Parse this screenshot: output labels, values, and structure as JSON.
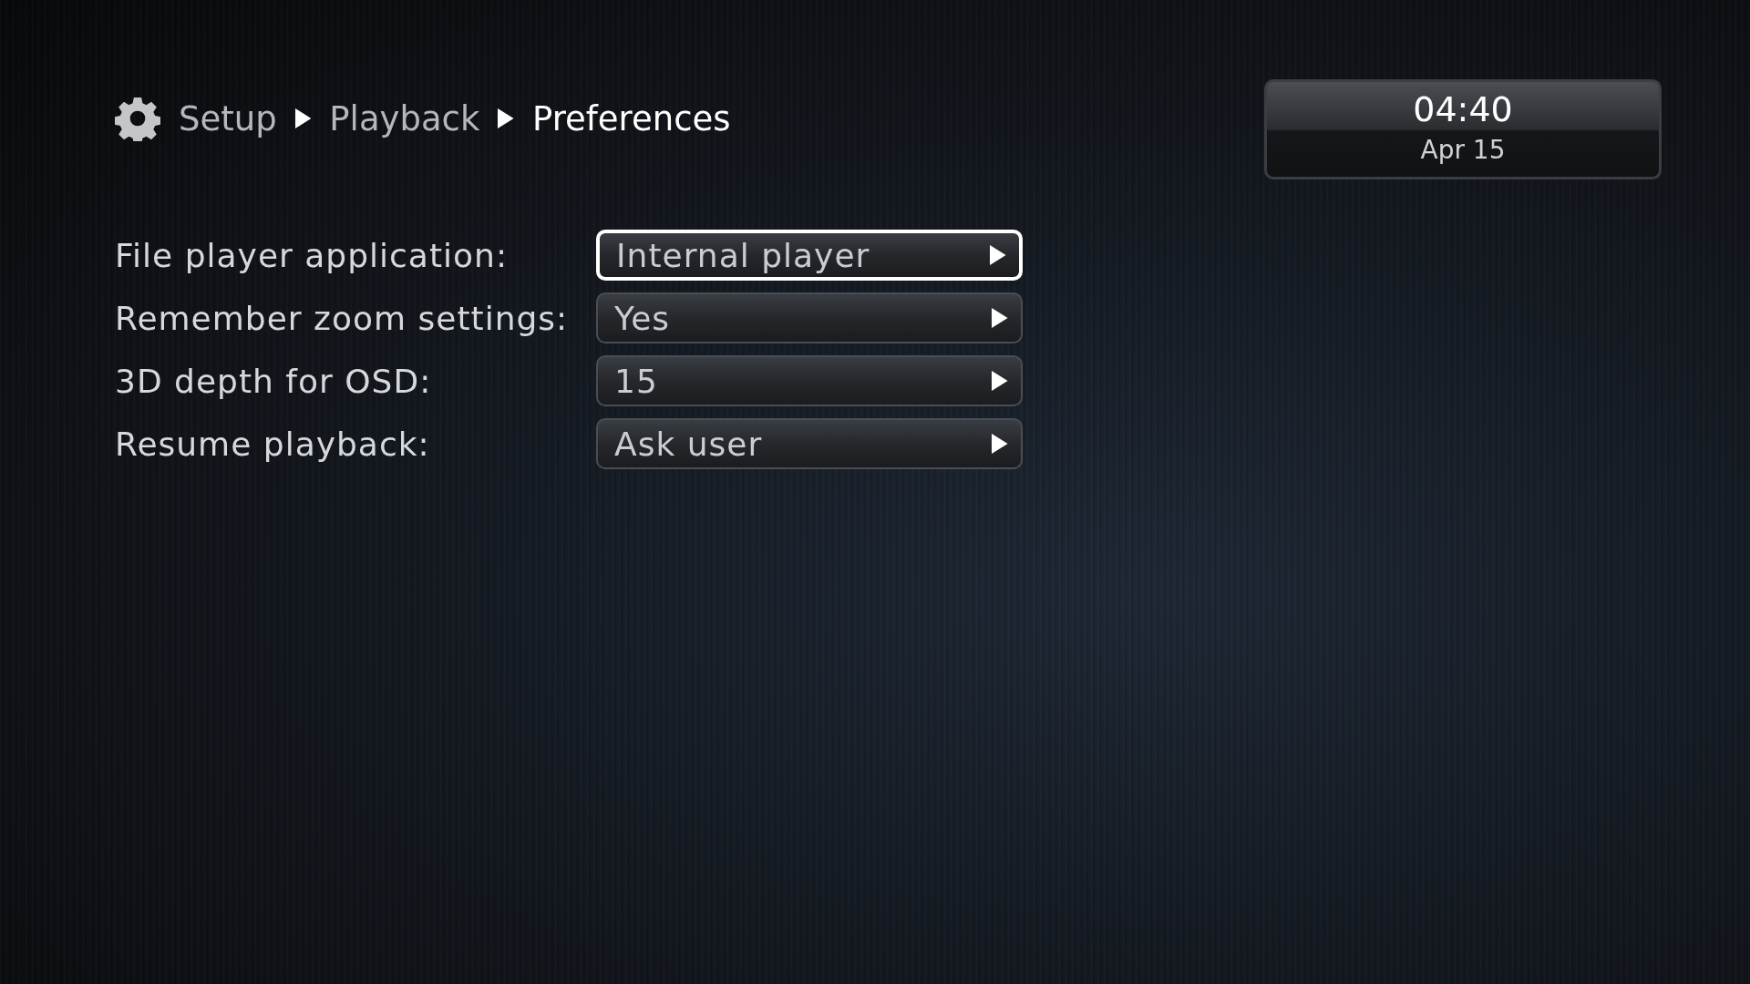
{
  "breadcrumb": [
    {
      "label": "Setup",
      "selected": false
    },
    {
      "label": "Playback",
      "selected": false
    },
    {
      "label": "Preferences",
      "selected": true
    }
  ],
  "clock": {
    "time": "04:40",
    "date": "Apr 15"
  },
  "settings": [
    {
      "label": "File player application:",
      "value": "Internal player",
      "selected": true
    },
    {
      "label": "Remember zoom settings:",
      "value": "Yes",
      "selected": false
    },
    {
      "label": "3D depth for OSD:",
      "value": "15",
      "selected": false
    },
    {
      "label": "Resume playback:",
      "value": "Ask user",
      "selected": false
    }
  ]
}
